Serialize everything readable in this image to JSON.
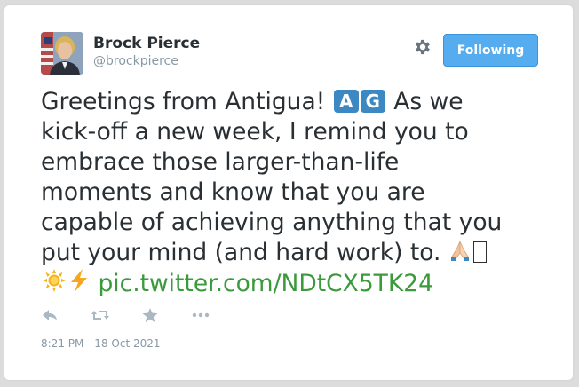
{
  "tweet": {
    "author_name": "Brock Pierce",
    "author_handle": "@brockpierce",
    "follow_button_label": "Following",
    "text_lines": [
      "Greetings from Antigua!",
      "As we",
      "kick-off a new week, I remind you to",
      "embrace those larger-than-life",
      "moments and know that you are",
      "capable of achieving anything that you",
      "put your mind (and hard work) to."
    ],
    "flag_letters": [
      "A",
      "G"
    ],
    "link_text": "pic.twitter.com/NDtCX5TK24",
    "timestamp": "8:21 PM - 18 Oct 2021"
  },
  "icons": {
    "settings": "gear-icon",
    "reply": "reply-icon",
    "retweet": "retweet-icon",
    "favorite": "star-icon",
    "more": "more-icon",
    "flag": "flag-antigua-icon",
    "praying_hands": "praying-hands-icon",
    "sun": "sun-icon",
    "lightning": "lightning-icon"
  },
  "colors": {
    "follow_button": "#55acee",
    "link": "#3b9a3b",
    "text": "#292f33",
    "muted": "#8899a6",
    "action_icon": "#aab8c2"
  }
}
